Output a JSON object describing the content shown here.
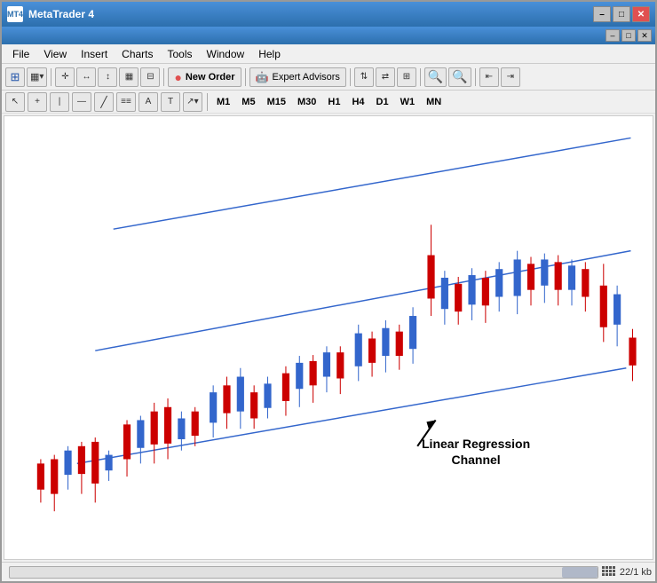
{
  "window": {
    "title": "MetaTrader 4",
    "icon": "MT4"
  },
  "titlebar": {
    "controls": {
      "minimize": "–",
      "maximize": "□",
      "close": "✕"
    }
  },
  "menubar": {
    "items": [
      "File",
      "View",
      "Insert",
      "Charts",
      "Tools",
      "Window",
      "Help"
    ]
  },
  "toolbar1": {
    "new_order_label": "New Order",
    "expert_advisors_label": "Expert Advisors"
  },
  "toolbar2": {
    "timeframes": [
      "M1",
      "M5",
      "M15",
      "M30",
      "H1",
      "H4",
      "D1",
      "W1",
      "MN"
    ]
  },
  "chart": {
    "annotation": {
      "line1": "Linear Regression",
      "line2": "Channel"
    }
  },
  "statusbar": {
    "info": "22/1 kb"
  }
}
